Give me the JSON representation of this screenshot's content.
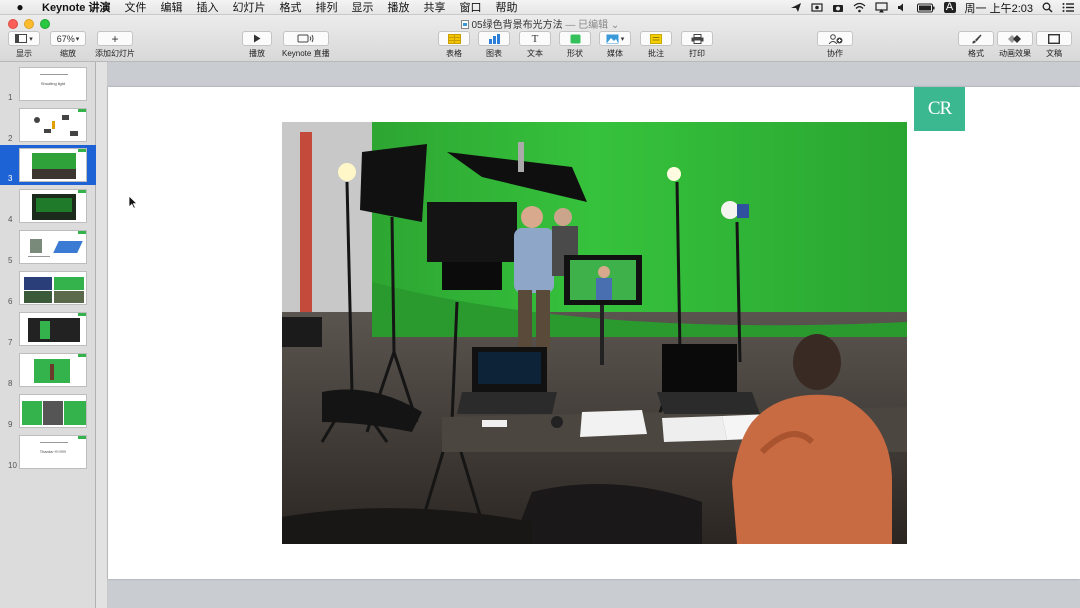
{
  "menubar": {
    "app_name": "Keynote 讲演",
    "items": [
      "文件",
      "编辑",
      "插入",
      "幻灯片",
      "格式",
      "排列",
      "显示",
      "播放",
      "共享",
      "窗口",
      "帮助"
    ],
    "clock": "周一 上午2:03",
    "input_method": "A"
  },
  "window": {
    "title": "05绿色背景布光方法",
    "status": "— 已编辑"
  },
  "toolbar": {
    "view_label": "显示",
    "zoom_value": "67%",
    "zoom_label": "缩放",
    "add_slide_label": "添加幻灯片",
    "play_label": "播放",
    "keynote_live_label": "Keynote 直播",
    "table_label": "表格",
    "chart_label": "图表",
    "text_label": "文本",
    "shape_label": "形状",
    "media_label": "媒体",
    "comment_label": "批注",
    "print_label": "打印",
    "collaborate_label": "协作",
    "format_label": "格式",
    "animate_label": "动画效果",
    "document_label": "文稿"
  },
  "navigator": {
    "slides": [
      {
        "num": "1",
        "text": "Shooting light"
      },
      {
        "num": "2",
        "text": ""
      },
      {
        "num": "3",
        "text": ""
      },
      {
        "num": "4",
        "text": ""
      },
      {
        "num": "5",
        "text": ""
      },
      {
        "num": "6",
        "text": ""
      },
      {
        "num": "7",
        "text": ""
      },
      {
        "num": "8",
        "text": ""
      },
      {
        "num": "9",
        "text": ""
      },
      {
        "num": "10",
        "text": "Thanks~!!!!!!!!!!"
      }
    ],
    "selected": "3"
  },
  "slide": {
    "logo_text": "CR"
  },
  "colors": {
    "selection_blue": "#1d63d6",
    "green_screen": "#2fbd3a",
    "logo_teal": "#3cb890"
  }
}
